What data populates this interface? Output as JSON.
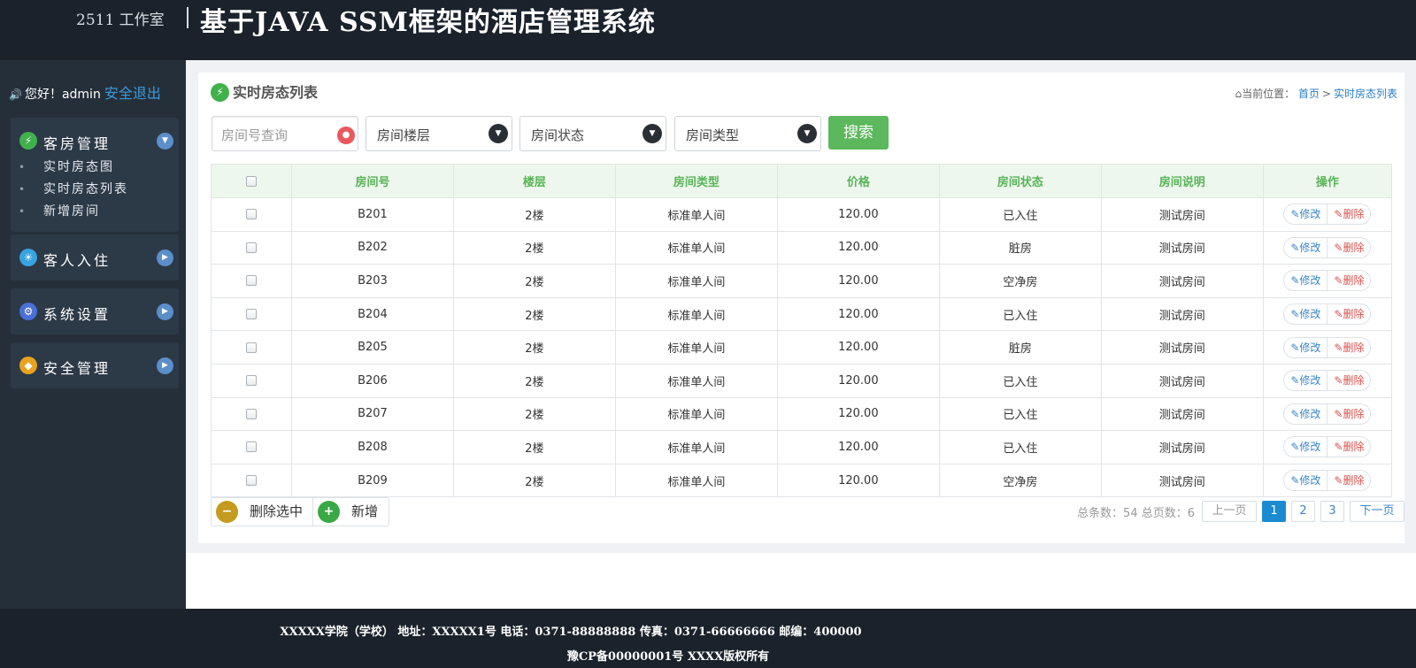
{
  "header": {
    "studio": "2511 工作室",
    "title": "基于JAVA SSM框架的酒店管理系统"
  },
  "sidebar": {
    "greeting": "您好！admin",
    "logout": "安全退出",
    "groups": [
      {
        "label": "客房管理",
        "icon": "lightning-icon",
        "icon_color": "#41b14b",
        "expanded": true,
        "items": [
          {
            "label": "实时房态图"
          },
          {
            "label": "实时房态列表"
          },
          {
            "label": "新增房间"
          }
        ]
      },
      {
        "label": "客人入住",
        "icon": "lightbulb-icon",
        "icon_color": "#37a3e0",
        "expanded": false
      },
      {
        "label": "系统设置",
        "icon": "gears-icon",
        "icon_color": "#4a6fd8",
        "expanded": false
      },
      {
        "label": "安全管理",
        "icon": "shield-icon",
        "icon_color": "#e8a21c",
        "expanded": false
      }
    ]
  },
  "panel": {
    "title": "实时房态列表",
    "breadcrumb": {
      "prefix": "当前位置：",
      "home": "首页",
      "separator": ">",
      "current": "实时房态列表"
    }
  },
  "filters": {
    "search_placeholder": "房间号查询",
    "floor": "房间楼层",
    "status": "房间状态",
    "type": "房间类型",
    "search_button": "搜索"
  },
  "table": {
    "columns": [
      "房间号",
      "楼层",
      "房间类型",
      "价格",
      "房间状态",
      "房间说明",
      "操作"
    ],
    "edit_label": "修改",
    "delete_label": "删除",
    "rows": [
      {
        "room": "B201",
        "floor": "2楼",
        "type": "标准单人间",
        "price": "120.00",
        "status": "已入住",
        "desc": "测试房间"
      },
      {
        "room": "B202",
        "floor": "2楼",
        "type": "标准单人间",
        "price": "120.00",
        "status": "脏房",
        "desc": "测试房间"
      },
      {
        "room": "B203",
        "floor": "2楼",
        "type": "标准单人间",
        "price": "120.00",
        "status": "空净房",
        "desc": "测试房间"
      },
      {
        "room": "B204",
        "floor": "2楼",
        "type": "标准单人间",
        "price": "120.00",
        "status": "已入住",
        "desc": "测试房间"
      },
      {
        "room": "B205",
        "floor": "2楼",
        "type": "标准单人间",
        "price": "120.00",
        "status": "脏房",
        "desc": "测试房间"
      },
      {
        "room": "B206",
        "floor": "2楼",
        "type": "标准单人间",
        "price": "120.00",
        "status": "已入住",
        "desc": "测试房间"
      },
      {
        "room": "B207",
        "floor": "2楼",
        "type": "标准单人间",
        "price": "120.00",
        "status": "已入住",
        "desc": "测试房间"
      },
      {
        "room": "B208",
        "floor": "2楼",
        "type": "标准单人间",
        "price": "120.00",
        "status": "已入住",
        "desc": "测试房间"
      },
      {
        "room": "B209",
        "floor": "2楼",
        "type": "标准单人间",
        "price": "120.00",
        "status": "空净房",
        "desc": "测试房间"
      }
    ]
  },
  "bulk_actions": {
    "delete_selected": "删除选中",
    "add": "新增"
  },
  "pagination": {
    "info": "总条数：54 总页数：6",
    "prev": "上一页",
    "pages": [
      "1",
      "2",
      "3"
    ],
    "current": "1",
    "next": "下一页"
  },
  "footer": {
    "line1": "XXXXX学院（学校） 地址：XXXXX1号 电话：0371-88888888 传真：0371-66666666 邮编：400000",
    "line2": "豫CP备00000001号 XXXX版权所有"
  }
}
